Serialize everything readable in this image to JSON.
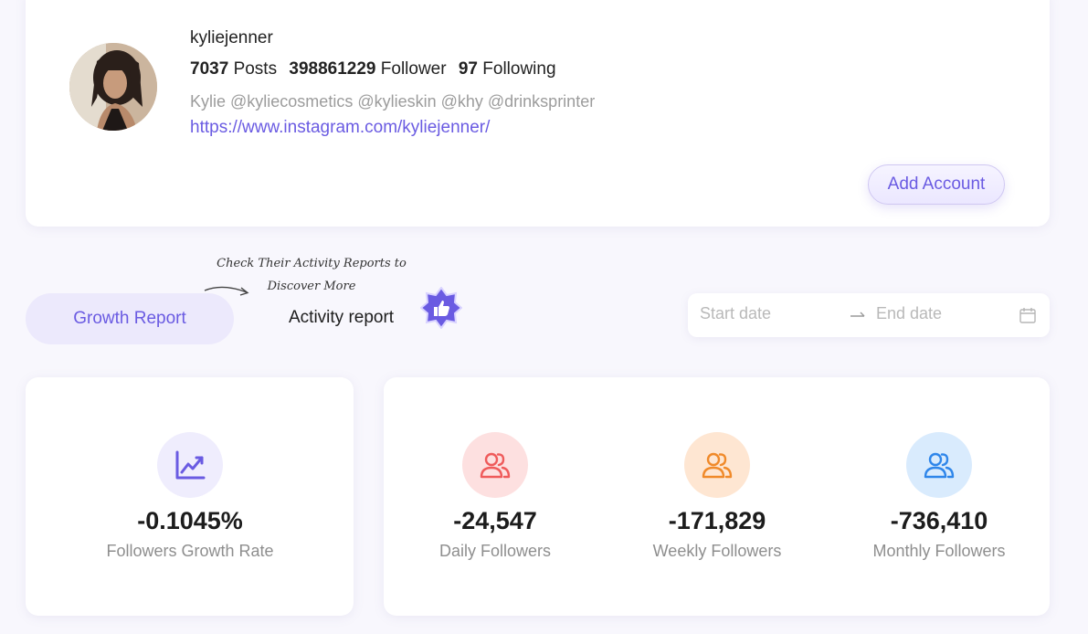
{
  "profile": {
    "username": "kyliejenner",
    "posts_count": "7037",
    "posts_label": "Posts",
    "followers_count": "398861229",
    "followers_label": "Follower",
    "following_count": "97",
    "following_label": "Following",
    "bio": "Kylie @kyliecosmetics @kylieskin @khy @drinksprinter",
    "link": "https://www.instagram.com/kyliejenner/",
    "add_account_label": "Add Account"
  },
  "tabs": {
    "growth_label": "Growth Report",
    "activity_label": "Activity report",
    "hint_line1": "Check Their Activity Reports to",
    "hint_line2": "Discover More"
  },
  "date_range": {
    "start_placeholder": "Start date",
    "end_placeholder": "End date"
  },
  "stats": {
    "growth_rate": {
      "value": "-0.1045%",
      "label": "Followers Growth Rate",
      "icon": "trending-up-icon",
      "color": "#6a5be2"
    },
    "daily": {
      "value": "-24,547",
      "label": "Daily Followers",
      "icon": "users-icon",
      "color": "#ef5b5b"
    },
    "weekly": {
      "value": "-171,829",
      "label": "Weekly Followers",
      "icon": "users-icon",
      "color": "#f08a2a"
    },
    "monthly": {
      "value": "-736,410",
      "label": "Monthly Followers",
      "icon": "users-icon",
      "color": "#2f86ea"
    }
  },
  "colors": {
    "accent": "#6a5be2",
    "tab_active_bg": "#ece9fc"
  }
}
